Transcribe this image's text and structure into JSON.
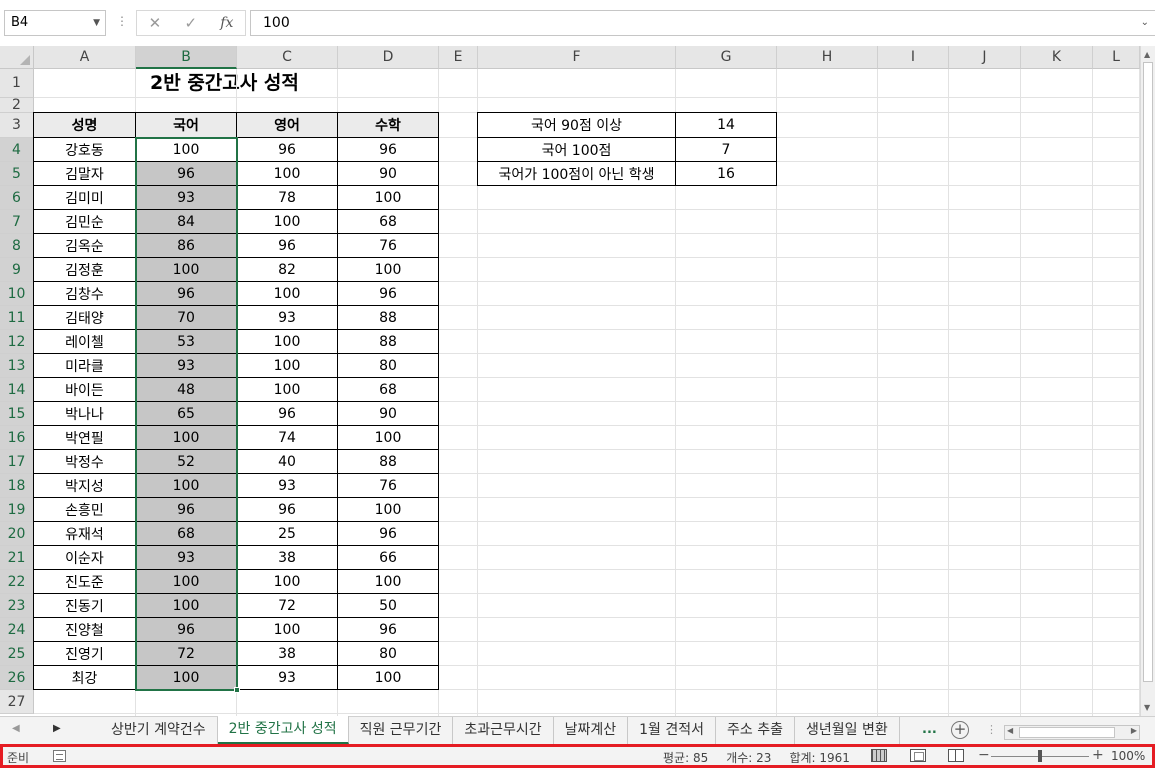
{
  "formula_bar": {
    "name_box": "B4",
    "formula": "100",
    "cancel_icon": "✕",
    "enter_icon": "✓",
    "fx_icon": "fx"
  },
  "title": "2반 중간고사 성적",
  "columns": [
    "A",
    "B",
    "C",
    "D",
    "E",
    "F",
    "G",
    "H",
    "I",
    "J",
    "K",
    "L"
  ],
  "rows": [
    "1",
    "2",
    "3",
    "4",
    "5",
    "6",
    "7",
    "8",
    "9",
    "10",
    "11",
    "12",
    "13",
    "14",
    "15",
    "16",
    "17",
    "18",
    "19",
    "20",
    "21",
    "22",
    "23",
    "24",
    "25",
    "26",
    "27"
  ],
  "table": {
    "headers": [
      "성명",
      "국어",
      "영어",
      "수학"
    ],
    "rows": [
      [
        "강호동",
        "100",
        "96",
        "96"
      ],
      [
        "김말자",
        "96",
        "100",
        "90"
      ],
      [
        "김미미",
        "93",
        "78",
        "100"
      ],
      [
        "김민순",
        "84",
        "100",
        "68"
      ],
      [
        "김옥순",
        "86",
        "96",
        "76"
      ],
      [
        "김정훈",
        "100",
        "82",
        "100"
      ],
      [
        "김창수",
        "96",
        "100",
        "96"
      ],
      [
        "김태양",
        "70",
        "93",
        "88"
      ],
      [
        "레이첼",
        "53",
        "100",
        "88"
      ],
      [
        "미라클",
        "93",
        "100",
        "80"
      ],
      [
        "바이든",
        "48",
        "100",
        "68"
      ],
      [
        "박나나",
        "65",
        "96",
        "90"
      ],
      [
        "박연필",
        "100",
        "74",
        "100"
      ],
      [
        "박정수",
        "52",
        "40",
        "88"
      ],
      [
        "박지성",
        "100",
        "93",
        "76"
      ],
      [
        "손흥민",
        "96",
        "96",
        "100"
      ],
      [
        "유재석",
        "68",
        "25",
        "96"
      ],
      [
        "이순자",
        "93",
        "38",
        "66"
      ],
      [
        "진도준",
        "100",
        "100",
        "100"
      ],
      [
        "진동기",
        "100",
        "72",
        "50"
      ],
      [
        "진양철",
        "96",
        "100",
        "96"
      ],
      [
        "진영기",
        "72",
        "38",
        "80"
      ],
      [
        "최강",
        "100",
        "93",
        "100"
      ]
    ]
  },
  "summary": [
    [
      "국어 90점 이상",
      "14"
    ],
    [
      "국어 100점",
      "7"
    ],
    [
      "국어가 100점이 아닌 학생",
      "16"
    ]
  ],
  "sheet_tabs": [
    "상반기 계약건수",
    "2반 중간고사 성적",
    "직원 근무기간",
    "초과근무시간",
    "날짜계산",
    "1월 견적서",
    "주소 추출",
    "생년월일 변환"
  ],
  "active_tab_index": 1,
  "tab_more": "...",
  "status_bar": {
    "ready": "준비",
    "average": "평균: 85",
    "count": "개수: 23",
    "sum": "합계: 1961",
    "zoom": "100%",
    "zoom_level": 1.0
  },
  "colors": {
    "accent": "#217346",
    "selection_fill": "#c6c6c6",
    "header_fill": "#ebebeb",
    "highlight_border": "#e51c23"
  }
}
